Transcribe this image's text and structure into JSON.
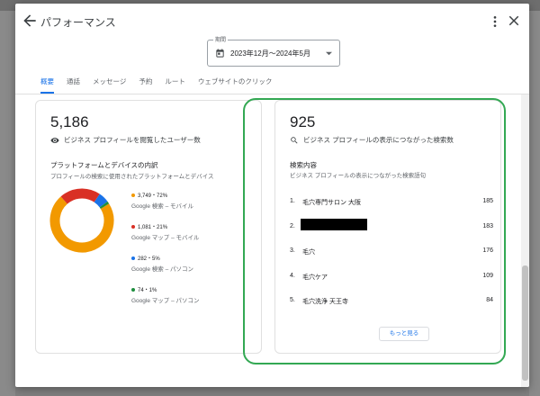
{
  "dialog": {
    "title": "パフォーマンス"
  },
  "period": {
    "label": "期間",
    "value": "2023年12月～2024年5月"
  },
  "tabs": [
    {
      "label": "概要",
      "active": true
    },
    {
      "label": "通話"
    },
    {
      "label": "メッセージ"
    },
    {
      "label": "予約"
    },
    {
      "label": "ルート"
    },
    {
      "label": "ウェブサイトのクリック"
    }
  ],
  "left_card": {
    "total": "5,186",
    "metric_label": "ビジネス プロフィールを閲覧したユーザー数",
    "section_title": "プラットフォームとデバイスの内訳",
    "section_subtitle": "プロフィールの検索に使用されたプラットフォームとデバイス",
    "legend": [
      {
        "value": "3,749・72%",
        "name": "Google 検索 – モバイル",
        "color": "#f29900"
      },
      {
        "value": "1,081・21%",
        "name": "Google マップ – モバイル",
        "color": "#d93025"
      },
      {
        "value": "282・5%",
        "name": "Google 検索 – パソコン",
        "color": "#1a73e8"
      },
      {
        "value": "74・1%",
        "name": "Google マップ – パソコン",
        "color": "#1e8e3e"
      }
    ]
  },
  "right_card": {
    "total": "925",
    "metric_label": "ビジネス プロフィールの表示につながった検索数",
    "section_title": "検索内容",
    "section_subtitle": "ビジネス プロフィールの表示につながった検索語句",
    "queries": [
      {
        "rank": "1.",
        "term": "毛穴専門サロン 大阪",
        "count": "185"
      },
      {
        "rank": "2.",
        "term": "",
        "count": "183",
        "redacted": true
      },
      {
        "rank": "3.",
        "term": "毛穴",
        "count": "176"
      },
      {
        "rank": "4.",
        "term": "毛穴ケア",
        "count": "109"
      },
      {
        "rank": "5.",
        "term": "毛穴洗浄 天王寺",
        "count": "84"
      }
    ],
    "more_label": "もっと見る"
  },
  "chart_data": {
    "type": "pie",
    "categories": [
      "Google 検索 – モバイル",
      "Google マップ – モバイル",
      "Google 検索 – パソコン",
      "Google マップ – パソコン"
    ],
    "values": [
      3749,
      1081,
      282,
      74
    ],
    "colors": [
      "#f29900",
      "#d93025",
      "#1a73e8",
      "#1e8e3e"
    ]
  },
  "colors": {
    "accent": "#1a73e8",
    "highlight": "#33a853"
  }
}
